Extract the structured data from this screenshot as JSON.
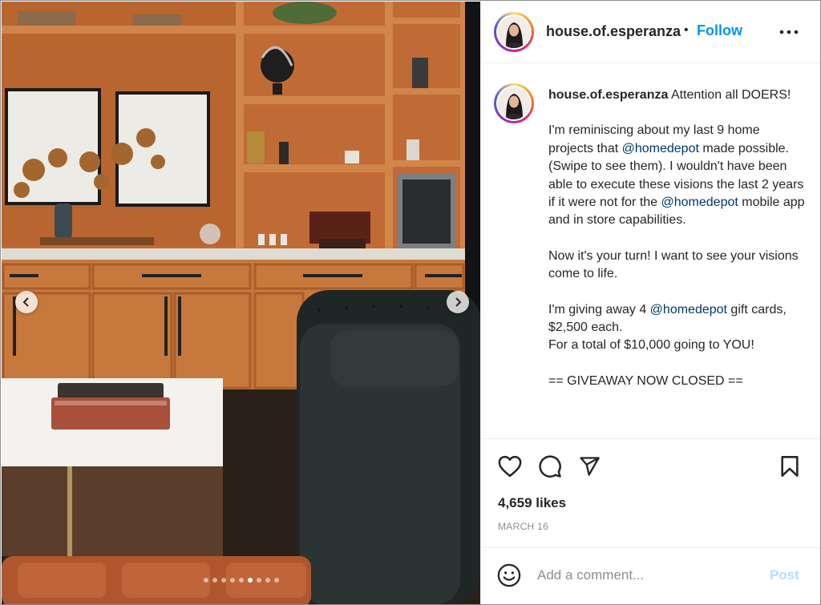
{
  "post": {
    "username": "house.of.esperanza",
    "separator": "•",
    "follow_label": "Follow",
    "more_icon": "more-horizontal-icon"
  },
  "caption": {
    "username": "house.of.esperanza",
    "line1": " Attention all DOERS!",
    "p2a": "I'm reminiscing about my last 9 home projects that ",
    "mention1": "@homedepot",
    "p2b": " made possible. (Swipe to see them). I wouldn't have been able to execute these visions the last 2 years if it were not for the ",
    "mention2": "@homedepot",
    "p2c": " mobile app and in store capabilities.",
    "p3": "Now it's your turn! I want to see your visions come to life.",
    "p4a": "I'm giving away 4 ",
    "mention3": "@homedepot",
    "p4b": " gift cards, $2,500 each.",
    "p4c": "For a total of $10,000 going to YOU!",
    "p5": "== GIVEAWAY NOW CLOSED =="
  },
  "stats": {
    "likes": "4,659 likes",
    "date": "MARCH 16"
  },
  "comment": {
    "placeholder": "Add a comment...",
    "post_label": "Post"
  },
  "carousel": {
    "total": 9,
    "active_index": 5
  },
  "colors": {
    "accent": "#0095f6",
    "mention": "#00376b",
    "cabinet": "#c2703a"
  }
}
